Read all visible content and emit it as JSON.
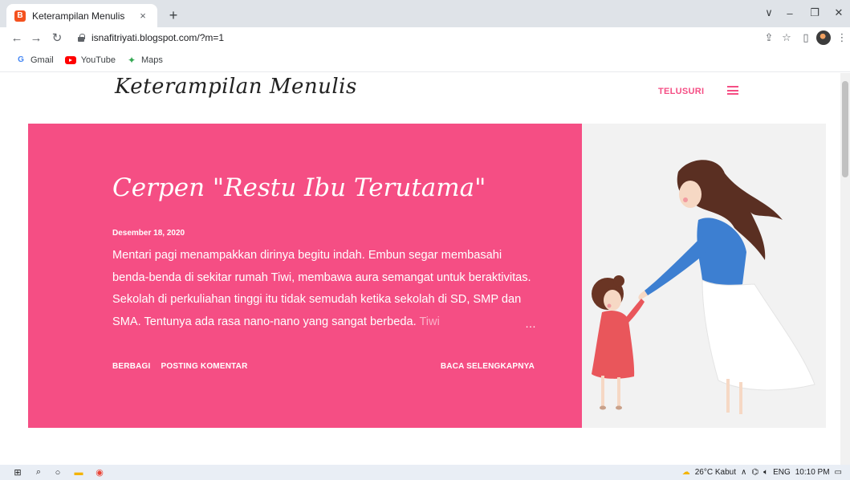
{
  "browser": {
    "tab_title": "Keterampilan Menulis",
    "tab_favicon_letter": "B",
    "tab_close": "×",
    "new_tab": "+",
    "url": "isnafitriyati.blogspot.com/?m=1",
    "window_controls": [
      "∨",
      "–",
      "❐",
      "✕"
    ]
  },
  "bookmarks": [
    {
      "label": "Gmail",
      "icon": "gmail-icon"
    },
    {
      "label": "YouTube",
      "icon": "youtube-icon"
    },
    {
      "label": "Maps",
      "icon": "maps-icon"
    }
  ],
  "blog": {
    "title": "Keterampilan Menulis",
    "explore": "TELUSURI",
    "accent_color": "#f54e84"
  },
  "post": {
    "title": "Cerpen \"Restu Ibu Terutama\"",
    "date": "Desember 18, 2020",
    "excerpt": "Mentari pagi menampakkan dirinya begitu indah. Embun segar membasahi benda-benda di sekitar rumah Tiwi, membawa aura semangat untuk beraktivitas. Sekolah di perkuliahan tinggi itu tidak semudah ketika sekolah di SD, SMP dan SMA. Tentunya ada rasa nano-nano yang sangat berbeda.",
    "excerpt_fade": "Tiwi",
    "ellipsis": "…",
    "share": "BERBAGI",
    "comment": "POSTING KOMENTAR",
    "read_more": "BACA SELENGKAPNYA"
  },
  "taskbar": {
    "weather": "26°C Kabut",
    "lang": "ENG",
    "time": "10:10 PM"
  }
}
